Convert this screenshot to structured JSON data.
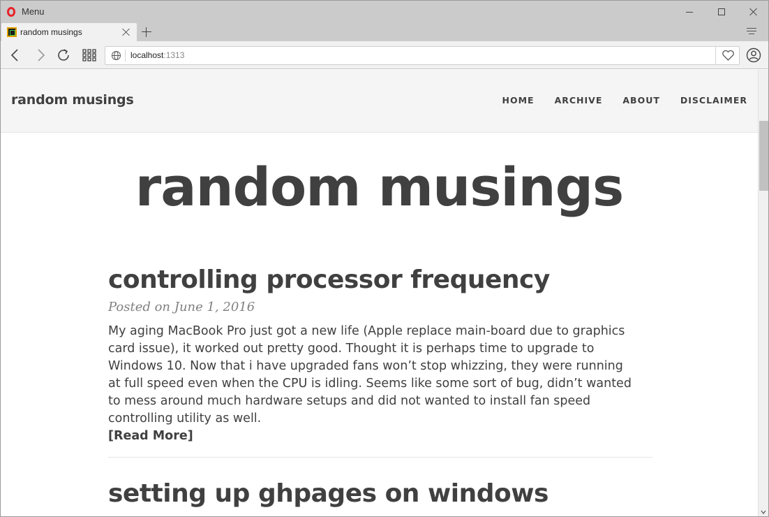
{
  "browser": {
    "menu_label": "Menu",
    "tab": {
      "title": "random musings"
    },
    "address": {
      "host": "localhost",
      "port": ":1313"
    }
  },
  "site": {
    "brand": "random musings",
    "nav": [
      {
        "label": "HOME"
      },
      {
        "label": "ARCHIVE"
      },
      {
        "label": "ABOUT"
      },
      {
        "label": "DISCLAIMER"
      }
    ],
    "hero_title": "random musings"
  },
  "posts": [
    {
      "title": "controlling processor frequency",
      "meta": "Posted on June 1, 2016",
      "excerpt": "My aging MacBook Pro just got a new life (Apple replace main-board due to graphics card issue), it worked out pretty good. Thought it is perhaps time to upgrade to Windows 10. Now that i have upgraded fans won’t stop whizzing, they were running at full speed even when the CPU is idling. Seems like some sort of bug, didn’t wanted to mess around much hardware setups and did not wanted to install fan speed controlling utility as well.",
      "read_more": "[Read More]"
    },
    {
      "title": "setting up ghpages on windows"
    }
  ],
  "colors": {
    "text": "#404040",
    "meta": "#808080",
    "nav_bg": "#f5f5f5",
    "chrome_bg": "#cbcbcb",
    "opera_red": "#e8232b"
  },
  "icons": [
    "opera-logo-icon",
    "close-icon",
    "plus-icon",
    "tab-menu-icon",
    "back-icon",
    "forward-icon",
    "reload-icon",
    "speed-dial-icon",
    "globe-icon",
    "heart-icon",
    "profile-icon"
  ]
}
